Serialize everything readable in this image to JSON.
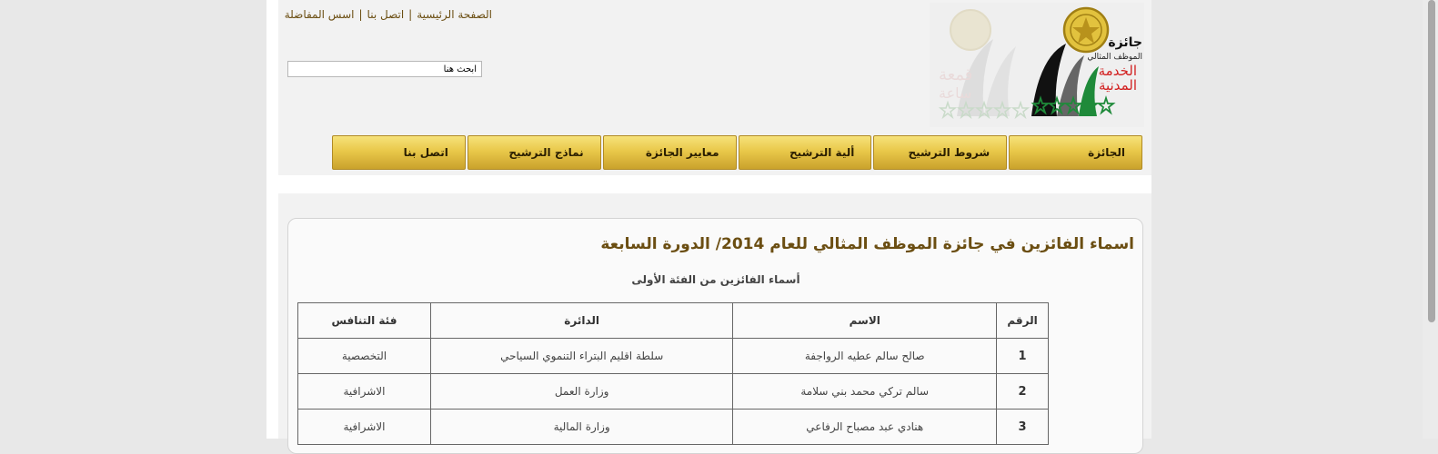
{
  "top_links": [
    "الصفحة الرئيسية",
    "اتصل بنا",
    "اسس المفاضلة"
  ],
  "search": {
    "placeholder": "ابحث هنا"
  },
  "logo": {
    "line1": "جائزة",
    "line2": "الموظف المثالي",
    "line3": "الخدمة",
    "line4": "المدنية"
  },
  "nav": [
    "الجائزة",
    "شروط الترشيح",
    "ألية الترشيح",
    "معايير الجائزة",
    "نماذج الترشيح",
    "اتصل بنا"
  ],
  "content": {
    "title": "اسماء الفائزين في جائزة الموظف المثالي للعام 2014/ الدورة السابعة",
    "subtitle": "أسماء الفائزين من الفئة الأولى",
    "table": {
      "headers": [
        "الرقم",
        "الاسم",
        "الدائرة",
        "فئة التنافس"
      ],
      "rows": [
        [
          "1",
          "صالح سالم عطيه الرواجفة",
          "سلطة اقليم البتراء التنموي السياحي",
          "التخصصية"
        ],
        [
          "2",
          "سالم تركي محمد بني سلامة",
          "وزارة العمل",
          "الاشرافية"
        ],
        [
          "3",
          "هنادي عبد مصباح الرفاعي",
          "وزارة المالية",
          "الاشرافية"
        ]
      ]
    }
  },
  "colors": {
    "accent": "#6b4e12",
    "nav_gold": "#e9c84a",
    "logo_red": "#d21f1f",
    "logo_green": "#1f8a3a"
  }
}
